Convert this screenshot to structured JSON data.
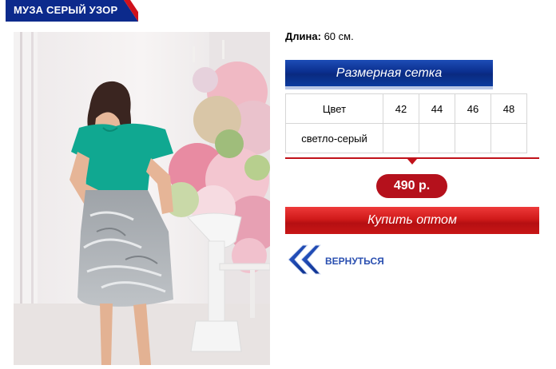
{
  "product": {
    "title": "МУЗА СЕРЫЙ УЗОР",
    "length_label": "Длина:",
    "length_value": "60 см."
  },
  "size_chart_button": "Размерная сетка",
  "size_table": {
    "header_label": "Цвет",
    "sizes": [
      "42",
      "44",
      "46",
      "48"
    ],
    "rows": [
      {
        "color": "светло-серый",
        "cells": [
          "",
          "",
          "",
          ""
        ]
      }
    ]
  },
  "price": "490 р.",
  "buy_button": "Купить оптом",
  "back_link": "ВЕРНУТЬСЯ",
  "colors": {
    "brand_blue": "#0b2f8f",
    "accent_red": "#c1121a",
    "link_blue": "#2a4fb0"
  },
  "icons": {
    "back": "double-chevron-left-icon"
  }
}
